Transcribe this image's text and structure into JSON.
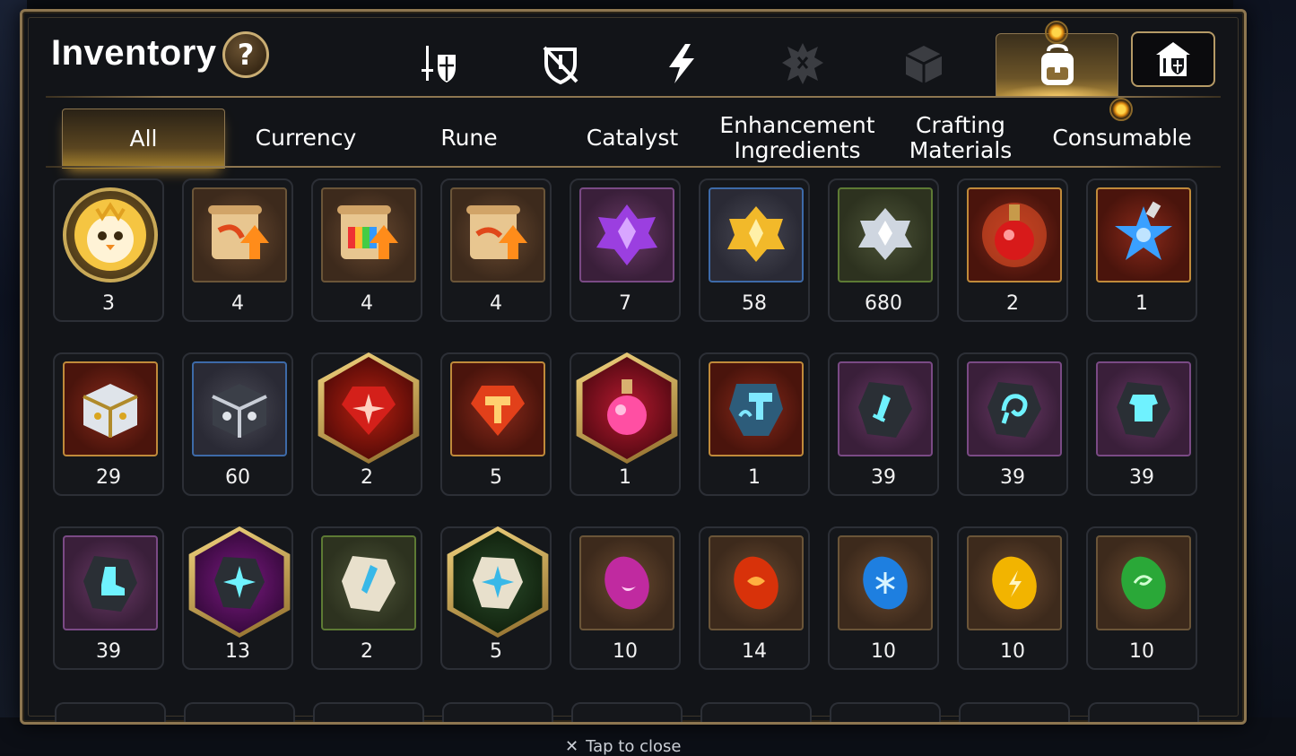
{
  "window": {
    "title": "Inventory",
    "help_label": "?"
  },
  "top_tabs": [
    {
      "icon": "sword-shield-icon",
      "active": false
    },
    {
      "icon": "broken-shield-icon",
      "active": false
    },
    {
      "icon": "lightning-icon",
      "active": false
    },
    {
      "icon": "spiked-gear-icon",
      "active": false
    },
    {
      "icon": "cube-icon",
      "active": false
    },
    {
      "icon": "backpack-icon",
      "active": true
    }
  ],
  "shop_button": {
    "icon": "castle-shop-icon"
  },
  "sub_tabs": [
    {
      "label": "All",
      "active": true
    },
    {
      "label": "Currency",
      "active": false
    },
    {
      "label": "Rune",
      "active": false
    },
    {
      "label": "Catalyst",
      "active": false
    },
    {
      "label": "Enhancement Ingredients",
      "active": false
    },
    {
      "label": "Crafting Materials",
      "active": false
    },
    {
      "label": "Consumable",
      "active": false
    }
  ],
  "items": [
    {
      "icon": "chick-token-icon",
      "qty": "3",
      "frame": "circle"
    },
    {
      "icon": "upgrade-scroll-icon",
      "qty": "4",
      "frame": "brown"
    },
    {
      "icon": "rainbow-scroll-icon",
      "qty": "4",
      "frame": "brown"
    },
    {
      "icon": "upgrade-scroll-icon",
      "qty": "4",
      "frame": "brown"
    },
    {
      "icon": "purple-crystal-icon",
      "qty": "7",
      "frame": "purple"
    },
    {
      "icon": "gold-crystal-icon",
      "qty": "58",
      "frame": "blue"
    },
    {
      "icon": "silver-crystal-icon",
      "qty": "680",
      "frame": "green"
    },
    {
      "icon": "red-potion-icon",
      "qty": "2",
      "frame": "red"
    },
    {
      "icon": "star-potion-icon",
      "qty": "1",
      "frame": "red"
    },
    {
      "icon": "gold-chest-icon",
      "qty": "29",
      "frame": "red"
    },
    {
      "icon": "silver-chest-icon",
      "qty": "60",
      "frame": "blue"
    },
    {
      "icon": "red-gem-icon",
      "qty": "2",
      "frame": "hex-red"
    },
    {
      "icon": "red-hammer-gem-icon",
      "qty": "5",
      "frame": "red"
    },
    {
      "icon": "pink-potion-icon",
      "qty": "1",
      "frame": "hex-pink"
    },
    {
      "icon": "blue-hammer-stone-icon",
      "qty": "1",
      "frame": "red"
    },
    {
      "icon": "sword-stone-icon",
      "qty": "39",
      "frame": "purple"
    },
    {
      "icon": "swirl-stone-icon",
      "qty": "39",
      "frame": "purple"
    },
    {
      "icon": "armor-stone-icon",
      "qty": "39",
      "frame": "purple"
    },
    {
      "icon": "boot-stone-icon",
      "qty": "39",
      "frame": "purple"
    },
    {
      "icon": "star-stone-icon",
      "qty": "13",
      "frame": "hex-purple"
    },
    {
      "icon": "white-sword-stone-icon",
      "qty": "2",
      "frame": "green"
    },
    {
      "icon": "white-star-stone-icon",
      "qty": "5",
      "frame": "hex-green"
    },
    {
      "icon": "moon-rune-icon",
      "qty": "10",
      "frame": "brown"
    },
    {
      "icon": "fire-rune-icon",
      "qty": "14",
      "frame": "brown"
    },
    {
      "icon": "frost-rune-icon",
      "qty": "10",
      "frame": "brown"
    },
    {
      "icon": "lightning-rune-icon",
      "qty": "10",
      "frame": "brown"
    },
    {
      "icon": "wind-rune-icon",
      "qty": "10",
      "frame": "brown"
    }
  ],
  "footer": {
    "close_icon": "x-icon",
    "close_label": "Tap to close"
  },
  "colors": {
    "gold_border": "#8d7650",
    "panel_bg": "#121418",
    "active_tab_glow": "#b08a3a",
    "notif": "#ffd54a"
  }
}
